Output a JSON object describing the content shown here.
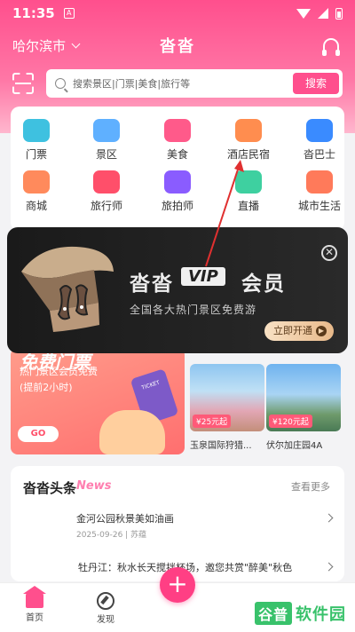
{
  "status": {
    "time": "11:35",
    "badge": "A"
  },
  "header": {
    "city": "哈尔滨市",
    "title": "沓沓"
  },
  "search": {
    "placeholder": "搜索景区|门票|美食|旅行等",
    "button": "搜索"
  },
  "categories": [
    {
      "label": "门票",
      "icon": "ticket-icon",
      "color": "#3ec1e0"
    },
    {
      "label": "景区",
      "icon": "mountain-icon",
      "color": "#5fb0ff"
    },
    {
      "label": "美食",
      "icon": "heart-bowl-icon",
      "color": "#ff5a8a"
    },
    {
      "label": "酒店民宿",
      "icon": "hotel-icon",
      "color": "#ff8d4f"
    },
    {
      "label": "沓巴士",
      "icon": "bus-icon",
      "color": "#3a8bff"
    },
    {
      "label": "商城",
      "icon": "shop-icon",
      "color": "#ff8a5c"
    },
    {
      "label": "旅行师",
      "icon": "luggage-icon",
      "color": "#ff4f6a"
    },
    {
      "label": "旅拍师",
      "icon": "camera-icon",
      "color": "#8a5cff"
    },
    {
      "label": "直播",
      "icon": "live-icon",
      "color": "#3ed0a0"
    },
    {
      "label": "城市生活",
      "icon": "city-icon",
      "color": "#ff7a5a"
    }
  ],
  "promo": {
    "title": "免费门票",
    "sub": "热门景区会员免费",
    "sub2": "(提前2小时)",
    "button": "GO",
    "ticket": "TICKET"
  },
  "spots": [
    {
      "name": "玉泉国际狩猎...",
      "price": "¥25元起"
    },
    {
      "name": "伏尔加庄园4A",
      "price": "¥120元起"
    }
  ],
  "news": {
    "title": "沓沓头条",
    "title_en": "News",
    "more": "查看更多",
    "item1": "金河公园秋景美如油画",
    "date1": "2025-09-26 | 苏蕴",
    "item2": "牡丹江：秋水长天搅拌杯场，邀您共赏\"醉美\"秋色"
  },
  "vip": {
    "brand": "沓沓",
    "badge": "VIP",
    "member": "会员",
    "desc": "全国各大热门景区免费游",
    "button": "立即开通"
  },
  "bottom_nav": {
    "home": "首页",
    "discover": "发现"
  },
  "watermark": {
    "a": "谷普",
    "b": "软件园"
  },
  "colors": {
    "brand": "#ff4f8d",
    "vip_bg": "#1e1e1e",
    "annotation": "#e03030"
  }
}
